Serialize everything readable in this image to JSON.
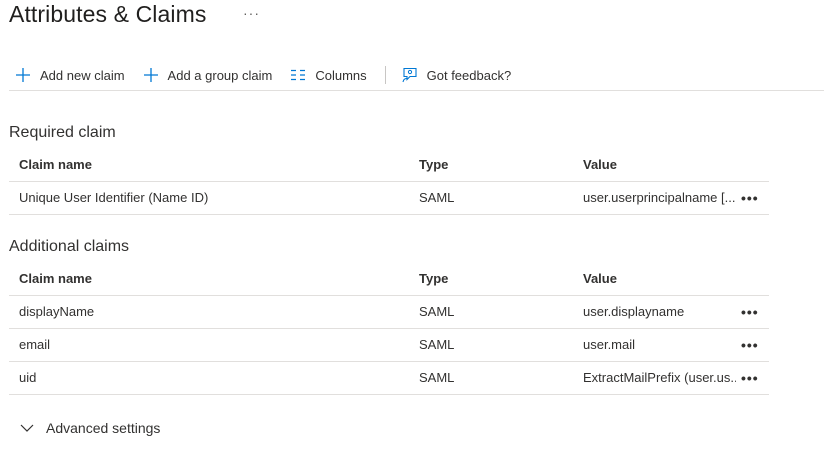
{
  "header": {
    "title": "Attributes & Claims",
    "more": "···"
  },
  "toolbar": {
    "add_new_claim": "Add new claim",
    "add_group_claim": "Add a group claim",
    "columns": "Columns",
    "feedback": "Got feedback?"
  },
  "required": {
    "title": "Required claim",
    "columns": {
      "name": "Claim name",
      "type": "Type",
      "value": "Value"
    },
    "rows": [
      {
        "name": "Unique User Identifier (Name ID)",
        "type": "SAML",
        "value": "user.userprincipalname [...",
        "more": "•••"
      }
    ]
  },
  "additional": {
    "title": "Additional claims",
    "columns": {
      "name": "Claim name",
      "type": "Type",
      "value": "Value"
    },
    "rows": [
      {
        "name": "displayName",
        "type": "SAML",
        "value": "user.displayname",
        "more": "•••"
      },
      {
        "name": "email",
        "type": "SAML",
        "value": "user.mail",
        "more": "•••"
      },
      {
        "name": "uid",
        "type": "SAML",
        "value": "ExtractMailPrefix (user.us...",
        "more": "•••"
      }
    ]
  },
  "advanced": {
    "label": "Advanced settings"
  },
  "colors": {
    "accent": "#0078d4",
    "border": "#e1dfdd",
    "text": "#323130"
  },
  "icons": {
    "add_new_claim": "plus-icon",
    "add_group_claim": "plus-icon",
    "columns": "columns-icon",
    "feedback": "feedback-icon",
    "advanced": "chevron-down-icon"
  }
}
